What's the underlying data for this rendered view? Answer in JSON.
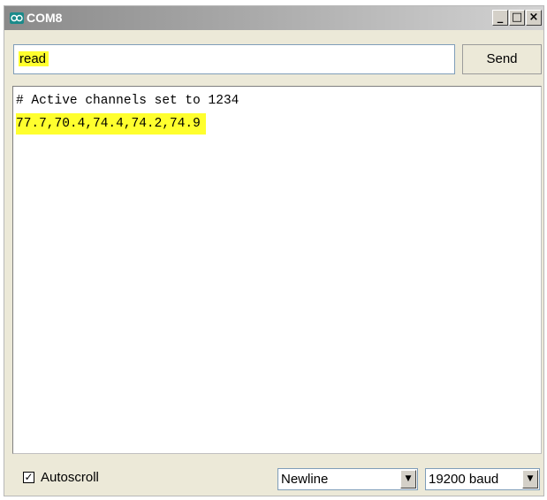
{
  "window": {
    "title": "COM8",
    "controls": {
      "minimize": "_",
      "maximize": "□",
      "close": "×"
    }
  },
  "send": {
    "input_value": "read",
    "button_label": "Send"
  },
  "output": {
    "lines": [
      "# Active channels set to 1234",
      "77.7,70.4,74.4,74.2,74.9"
    ],
    "highlight_color": "#ffff2e"
  },
  "footer": {
    "autoscroll_label": "Autoscroll",
    "autoscroll_checked": true,
    "checkmark": "✓",
    "line_ending": "Newline",
    "baud_rate": "19200 baud",
    "dropdown_arrow": "▼"
  },
  "icons": {
    "app": "arduino-logo-icon",
    "minimize": "minimize-icon",
    "maximize": "maximize-icon",
    "close": "close-icon",
    "dropdown": "chevron-down-icon"
  }
}
